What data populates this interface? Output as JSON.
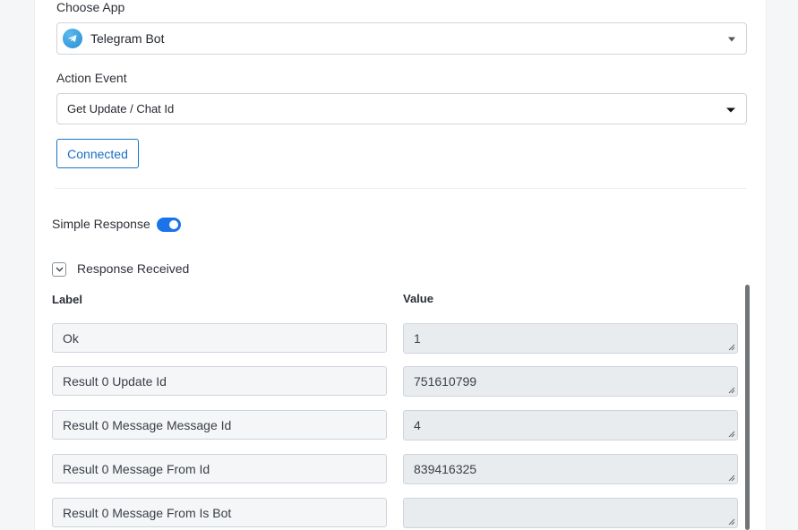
{
  "choose_app": {
    "label": "Choose App",
    "selected": "Telegram Bot",
    "icon": "telegram-icon"
  },
  "action_event": {
    "label": "Action Event",
    "selected": "Get Update / Chat Id"
  },
  "connected_button": {
    "label": "Connected"
  },
  "simple_response": {
    "label": "Simple Response",
    "enabled": true
  },
  "response_received": {
    "label": "Response Received"
  },
  "table": {
    "label_header": "Label",
    "value_header": "Value",
    "rows": [
      {
        "label": "Ok",
        "value": "1"
      },
      {
        "label": "Result 0 Update Id",
        "value": "751610799"
      },
      {
        "label": "Result 0 Message Message Id",
        "value": "4"
      },
      {
        "label": "Result 0 Message From Id",
        "value": "839416325"
      },
      {
        "label": "Result 0 Message From Is Bot",
        "value": ""
      }
    ]
  },
  "colors": {
    "accent": "#1a73e8",
    "telegram": "#2a9ae0"
  }
}
